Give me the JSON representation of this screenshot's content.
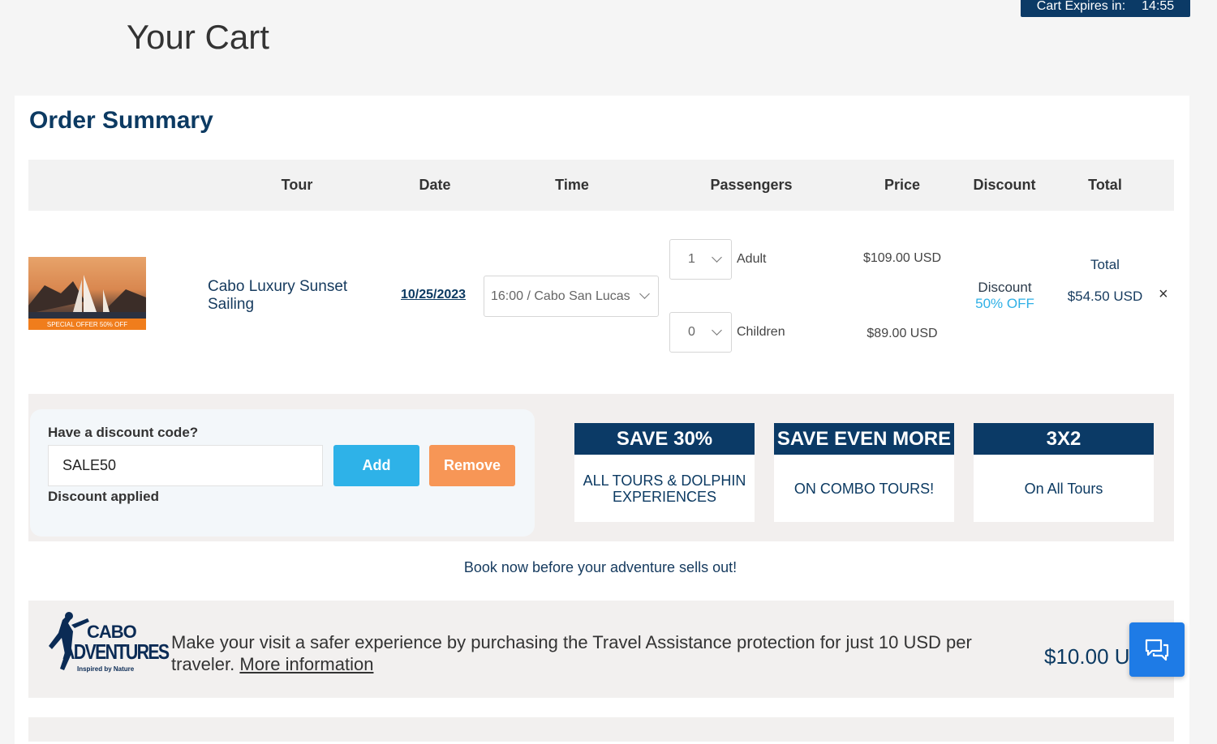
{
  "cart_timer": {
    "label": "Cart Expires in:",
    "value": "14:55"
  },
  "page_title": "Your Cart",
  "order": {
    "title": "Order Summary",
    "columns": [
      "Tour",
      "Date",
      "Time",
      "Passengers",
      "Price",
      "Discount",
      "Total"
    ],
    "item": {
      "image_ribbon": "SPECIAL OFFER 50% OFF",
      "tour_name": "Cabo Luxury Sunset Sailing",
      "date": "10/25/2023",
      "time_select": "16:00 / Cabo San Lucas",
      "adult_qty": "1",
      "adult_label": "Adult",
      "adult_price": "$109.00 USD",
      "children_qty": "0",
      "children_label": "Children",
      "children_price": "$89.00 USD",
      "discount_label": "Discount",
      "discount_value": "50% OFF",
      "total_label": "Total",
      "total_value": "$54.50 USD",
      "remove_symbol": "×"
    }
  },
  "discount_code": {
    "label": "Have a discount code?",
    "value": "SALE50",
    "add_label": "Add",
    "remove_label": "Remove",
    "status": "Discount applied"
  },
  "promos": [
    {
      "title": "SAVE 30%",
      "text": "ALL TOURS & DOLPHIN EXPERIENCES"
    },
    {
      "title": "SAVE EVEN MORE",
      "text": "ON COMBO TOURS!"
    },
    {
      "title": "3X2",
      "text": "On All Tours"
    }
  ],
  "book_now": "Book now before your adventure sells out!",
  "assistance": {
    "logo_text_1": "CABO",
    "logo_text_2": "ADVENTURES",
    "logo_tagline": "Inspired by Nature",
    "text": "Make your visit a safer experience by purchasing the Travel Assistance protection for just 10 USD per traveler.",
    "link": "More information",
    "price": "$10.00 U"
  },
  "colors": {
    "navy": "#0b3a66",
    "accent_blue": "#2eb2e8",
    "orange": "#f79656",
    "chat_blue": "#1e7be6"
  },
  "icons": {
    "chat": "chat-bubbles-icon",
    "close": "close-icon",
    "chevron": "chevron-down-icon"
  }
}
